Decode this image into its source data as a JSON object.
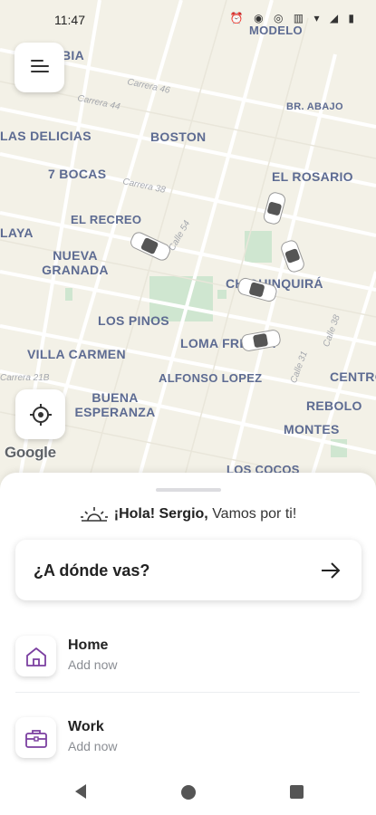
{
  "status_bar": {
    "time": "11:47",
    "icons": "⏰ ◉ ◎ ▥ ▾ ◢ ▮"
  },
  "map": {
    "labels": [
      "MODELO",
      "BIA",
      "LAS DELICIAS",
      "BOSTON",
      "BR. ABAJO",
      "7 BOCAS",
      "EL ROSARIO",
      "EL RECREO",
      "LAYA",
      "NUEVA GRANADA",
      "CHIQUINQUIRÁ",
      "LOS PINOS",
      "LOMA FRESCA",
      "VILLA CARMEN",
      "ALFONSO LOPEZ",
      "CENTRO",
      "BUENA ESPERANZA",
      "REBOLO",
      "MONTES",
      "LOS COCOS"
    ],
    "streets": [
      "Carrera 46",
      "Carrera 44",
      "Carrera 38",
      "Calle 54",
      "Carrera 21B",
      "Calle 31",
      "Calle 38"
    ],
    "attribution": "Google"
  },
  "sheet": {
    "greeting_bold": "¡Hola! Sergio,",
    "greeting_rest": " Vamos por ti!",
    "destination_prompt": "¿A dónde vas?",
    "places": [
      {
        "title": "Home",
        "subtitle": "Add now",
        "icon": "home-icon"
      },
      {
        "title": "Work",
        "subtitle": "Add now",
        "icon": "briefcase-icon"
      }
    ]
  },
  "colors": {
    "accent": "#7b3fa0",
    "map_label": "#5d6b92"
  }
}
